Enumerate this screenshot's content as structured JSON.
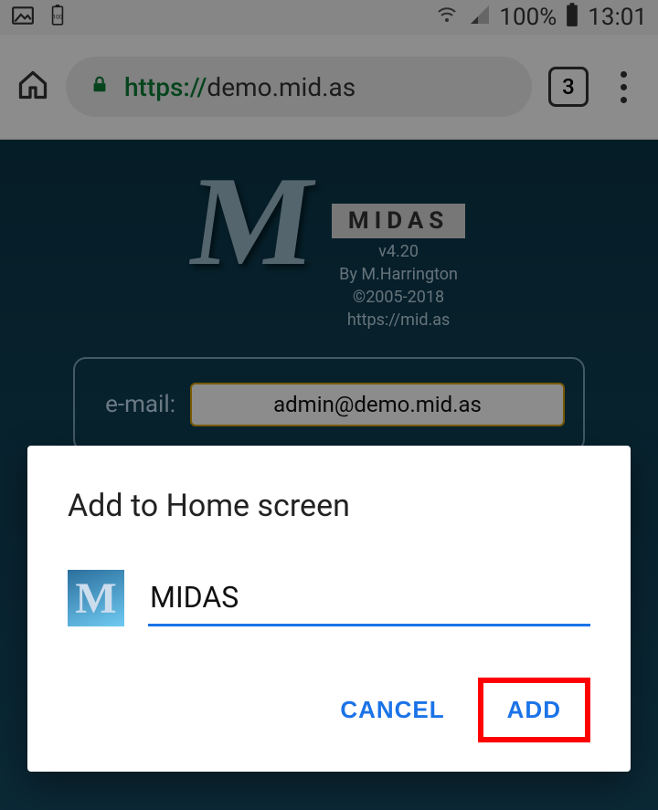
{
  "status_bar": {
    "battery_pct": "100%",
    "time": "13:01"
  },
  "url_bar": {
    "protocol": "https://",
    "host": "demo.mid.as",
    "tab_count": "3"
  },
  "page": {
    "heading": "MIDAS",
    "version": "v4.20",
    "byline": "By M.Harrington",
    "copyright": "©2005-2018",
    "link": "https://mid.as",
    "email_label": "e-mail:",
    "email_value": "admin@demo.mid.as"
  },
  "dialog": {
    "title": "Add to Home screen",
    "name_value": "MIDAS",
    "cancel": "CANCEL",
    "add": "ADD"
  }
}
